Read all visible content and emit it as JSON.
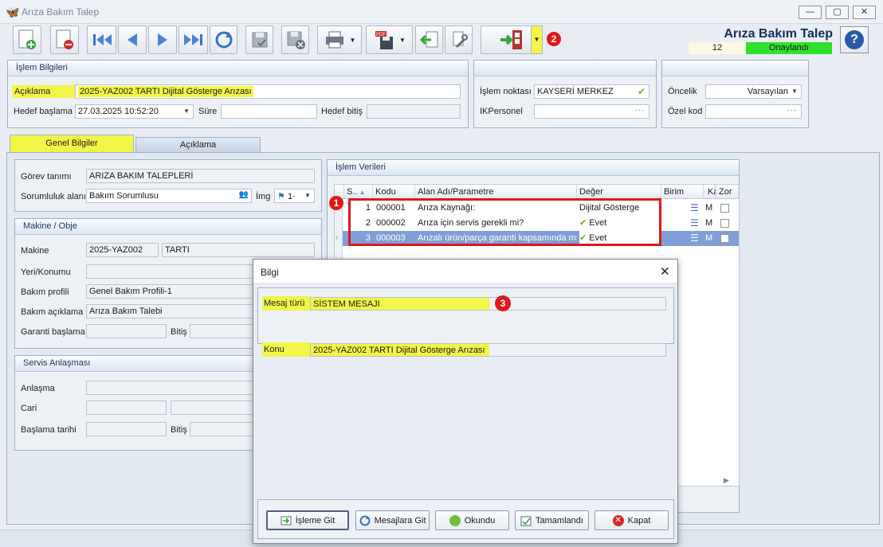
{
  "window": {
    "title": "Arıza Bakım Talep",
    "minimize": "—",
    "maximize": "▢",
    "close": "✕"
  },
  "toolbar": {
    "icons": [
      "new-document-icon",
      "delete-document-icon",
      "first-record-icon",
      "previous-record-icon",
      "next-record-icon",
      "last-record-icon",
      "refresh-icon",
      "save-icon",
      "save-close-icon",
      "print-icon",
      "pdf-export-icon",
      "import-icon",
      "tools-icon",
      "exit-icon"
    ]
  },
  "header": {
    "title": "Arıza Bakım Talep",
    "record_no": "12",
    "status": "Onaylandı",
    "help": "?"
  },
  "islem_bilgileri": {
    "title": "İşlem Bilgileri",
    "aciklama_label": "Açıklama",
    "aciklama_value": "2025-YAZ002 TARTI Dijital Gösterge Arızası",
    "hedef_baslama_label": "Hedef başlama",
    "hedef_baslama_value": "27.03.2025 10:52:20",
    "sure_label": "Süre",
    "sure_value": "",
    "hedef_bitis_label": "Hedef bitiş",
    "hedef_bitis_value": ""
  },
  "islem_noktasi": {
    "label": "İşlem noktası",
    "value": "KAYSERİ MERKEZ",
    "ikpersonel_label": "IKPersonel",
    "ikpersonel_value": ""
  },
  "oncelik": {
    "label": "Öncelik",
    "value": "Varsayılan",
    "ozel_kod_label": "Özel kod",
    "ozel_kod_value": ""
  },
  "tabs": [
    {
      "label": "Genel Bilgiler",
      "active": true
    },
    {
      "label": "Açıklama",
      "active": false
    }
  ],
  "genel": {
    "gorev_tanimi_label": "Görev tanımı",
    "gorev_tanimi_value": "ARIZA BAKIM TALEPLERİ",
    "sorumluluk_label": "Sorumluluk alanı",
    "sorumluluk_value": "Bakım Sorumlusu",
    "img_label": "İmg",
    "img_value": "1·"
  },
  "makine": {
    "title": "Makine / Obje",
    "makine_label": "Makine",
    "makine_code": "2025-YAZ002",
    "makine_name": "TARTI",
    "yeri_label": "Yeri/Konumu",
    "bakim_profili_label": "Bakım profili",
    "bakim_profili_value": "Genel Bakım Profili-1",
    "bakim_aciklama_label": "Bakım açıklama",
    "bakim_aciklama_value": "Arıza Bakım Talebi",
    "garanti_label": "Garanti başlama",
    "bitis_label": "Bitiş"
  },
  "servis": {
    "title": "Servis Anlaşması",
    "anlasma_label": "Anlaşma",
    "cari_label": "Cari",
    "baslama_label": "Başlama tarihi",
    "bitis_label": "Bitiş"
  },
  "islem_verileri": {
    "title": "İşlem Verileri",
    "columns": [
      "S..",
      "Kodu",
      "Alan Adı/Parametre",
      "Değer",
      "Birim",
      "Ka",
      "Zor"
    ],
    "rows": [
      {
        "no": "1",
        "kodu": "000001",
        "alan": "Arıza Kaynağı:",
        "deger": "Dijital Gösterge",
        "check": false,
        "ka": "M"
      },
      {
        "no": "2",
        "kodu": "000002",
        "alan": "Arıza için servis gerekli mi?",
        "deger": "Evet",
        "check": true,
        "ka": "M"
      },
      {
        "no": "3",
        "kodu": "000003",
        "alan": "Arızalı ürün/parça garanti kapsamında mı?",
        "deger": "Evet",
        "check": true,
        "ka": "M"
      }
    ]
  },
  "markers": [
    "1",
    "2",
    "3"
  ],
  "dialog": {
    "title": "Bilgi",
    "close": "✕",
    "mesaj_turu_label": "Mesaj türü",
    "mesaj_turu_value": "SİSTEM MESAJI",
    "konu_label": "Konu",
    "konu_value": "2025-YAZ002 TARTI Dijital Gösterge Arızası",
    "buttons": [
      "İşleme Git",
      "Mesajlara Git",
      "Okundu",
      "Tamamlandı",
      "Kapat"
    ]
  },
  "colors": {
    "highlight": "#f3f548",
    "status_green": "#2fe02f",
    "marker_red": "#e01818",
    "selected_row": "#7f9fd6"
  }
}
